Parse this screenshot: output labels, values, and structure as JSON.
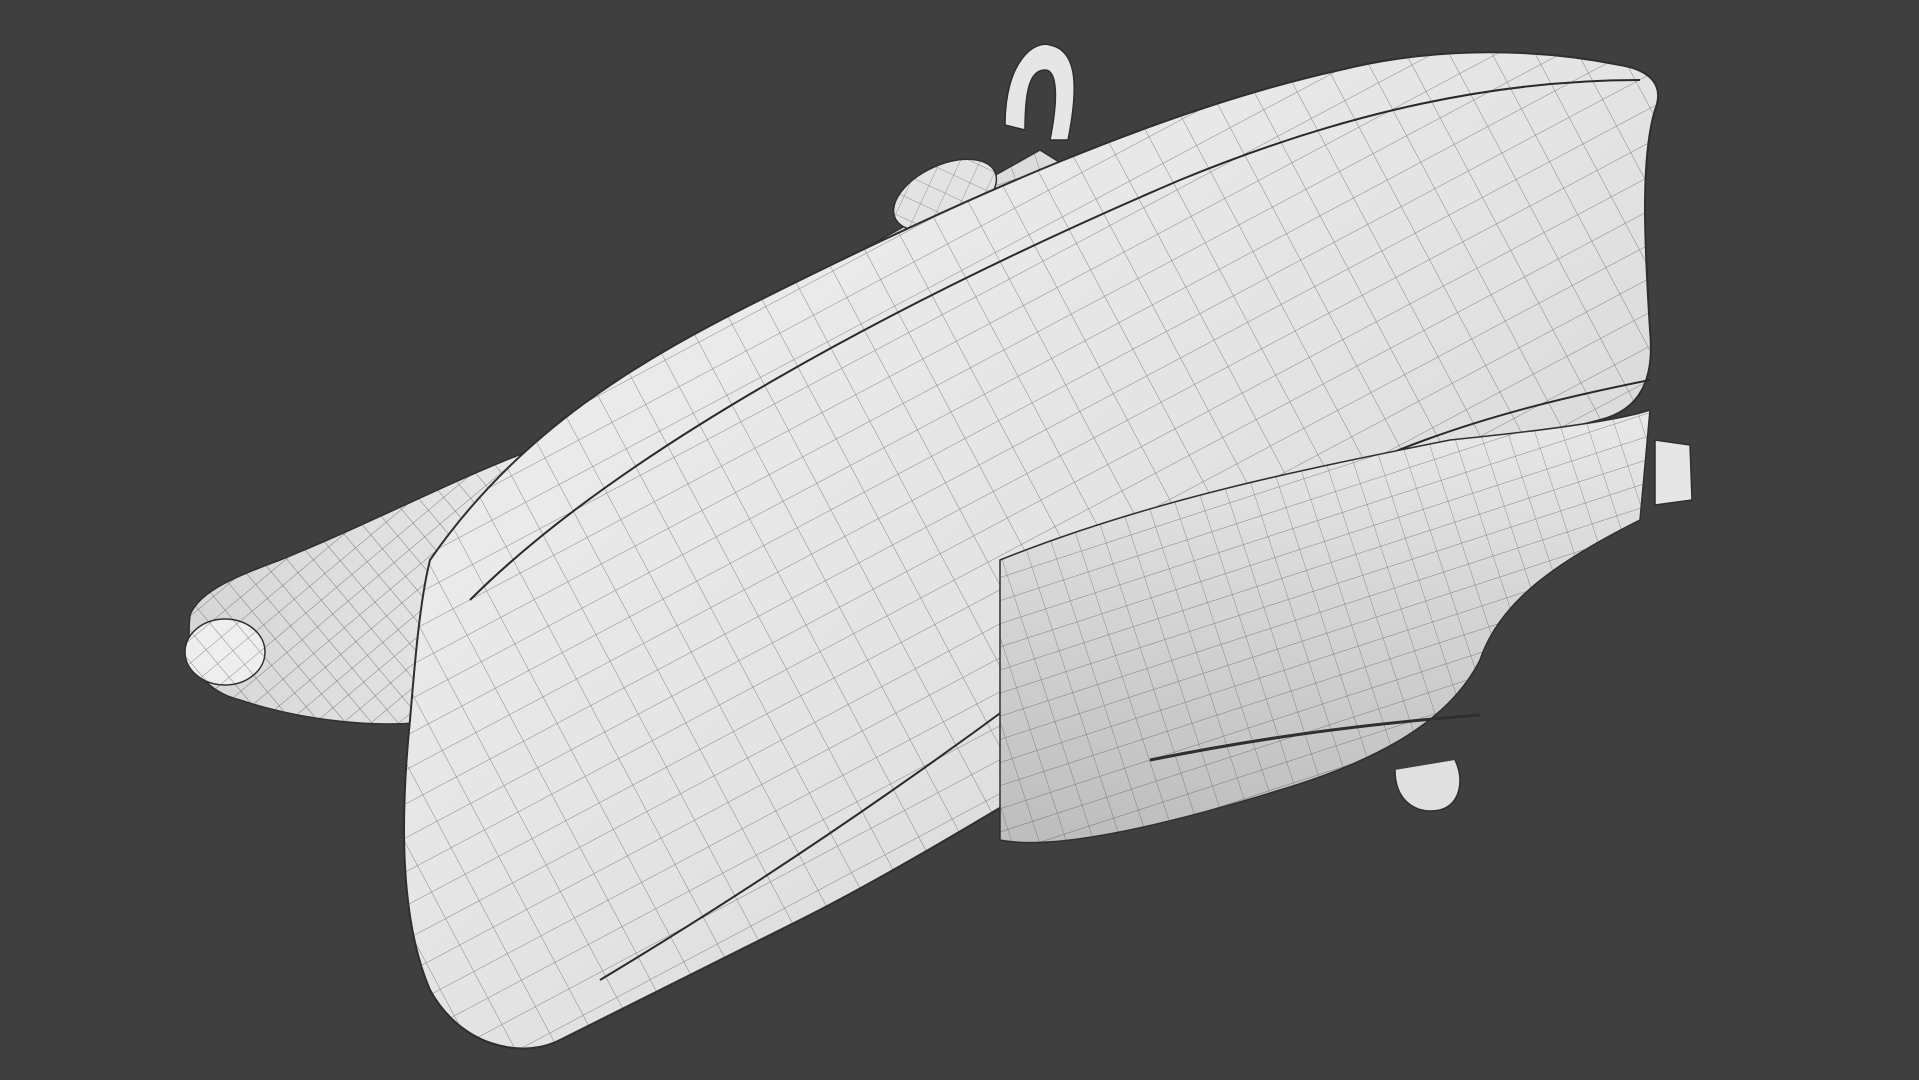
{
  "viewport": {
    "background_color": "#3f3f3f",
    "mesh_fill_color": "#e6e6e6",
    "mesh_shade_color": "#c9c9c9",
    "wire_color": "#2f2f2f"
  },
  "model": {
    "type": "3d-wireframe-render",
    "subject": "saddle-bag"
  }
}
